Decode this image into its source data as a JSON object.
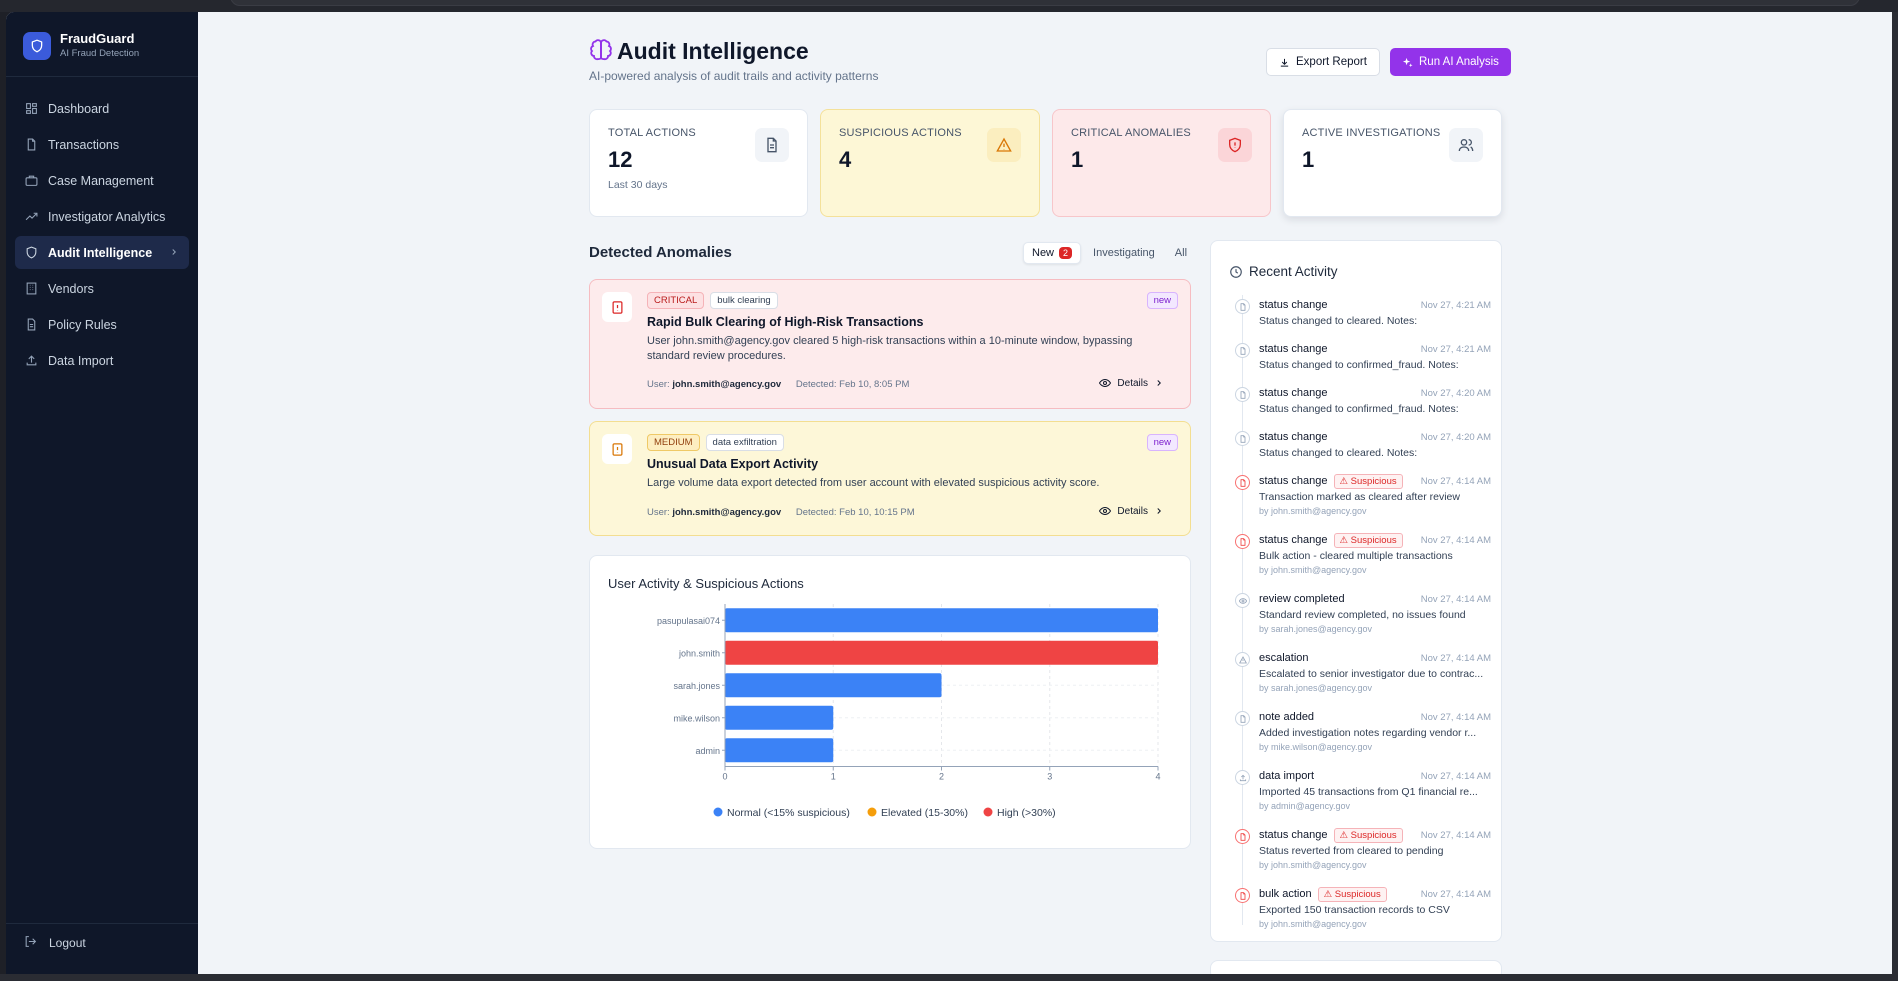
{
  "sidebar": {
    "brand_name": "FraudGuard",
    "brand_sub": "AI Fraud Detection",
    "items": [
      {
        "label": "Dashboard",
        "icon": "dashboard-icon"
      },
      {
        "label": "Transactions",
        "icon": "file-icon"
      },
      {
        "label": "Case Management",
        "icon": "briefcase-icon"
      },
      {
        "label": "Investigator Analytics",
        "icon": "trend-icon"
      },
      {
        "label": "Audit Intelligence",
        "icon": "shield-icon",
        "active": true
      },
      {
        "label": "Vendors",
        "icon": "building-icon"
      },
      {
        "label": "Policy Rules",
        "icon": "document-icon"
      },
      {
        "label": "Data Import",
        "icon": "upload-icon"
      }
    ],
    "logout": "Logout"
  },
  "header": {
    "title": "Audit Intelligence",
    "subtitle": "AI-powered analysis of audit trails and activity patterns",
    "export_label": "Export Report",
    "run_label": "Run AI Analysis"
  },
  "stats": [
    {
      "label": "TOTAL ACTIONS",
      "value": "12",
      "note": "Last 30 days"
    },
    {
      "label": "SUSPICIOUS ACTIONS",
      "value": "4",
      "note": ""
    },
    {
      "label": "CRITICAL ANOMALIES",
      "value": "1",
      "note": ""
    },
    {
      "label": "ACTIVE INVESTIGATIONS",
      "value": "1",
      "note": ""
    }
  ],
  "anomalies": {
    "title": "Detected Anomalies",
    "tabs": {
      "new": "New",
      "new_count": "2",
      "investigating": "Investigating",
      "all": "All"
    },
    "items": [
      {
        "severity": "CRITICAL",
        "category": "bulk clearing",
        "status": "new",
        "title": "Rapid Bulk Clearing of High-Risk Transactions",
        "description": "User john.smith@agency.gov cleared 5 high-risk transactions within a 10-minute window, bypassing standard review procedures.",
        "user_prefix": "User:",
        "user": "john.smith@agency.gov",
        "detected": "Detected: Feb 10, 8:05 PM",
        "details": "Details"
      },
      {
        "severity": "MEDIUM",
        "category": "data exfiltration",
        "status": "new",
        "title": "Unusual Data Export Activity",
        "description": "Large volume data export detected from user account with elevated suspicious activity score.",
        "user_prefix": "User:",
        "user": "john.smith@agency.gov",
        "detected": "Detected: Feb 10, 10:15 PM",
        "details": "Details"
      }
    ]
  },
  "chart_data": {
    "type": "bar",
    "orientation": "horizontal",
    "title": "User Activity & Suspicious Actions",
    "categories": [
      "pasupulasai074",
      "john.smith",
      "sarah.jones",
      "mike.wilson",
      "admin"
    ],
    "values": [
      4,
      4,
      2,
      1,
      1
    ],
    "levels": [
      "normal",
      "high",
      "normal",
      "normal",
      "normal"
    ],
    "xlim": [
      0,
      4
    ],
    "xticks": [
      "0",
      "1",
      "2",
      "3",
      "4"
    ],
    "grid": true,
    "legend_position": "bottom",
    "legend": [
      {
        "name": "Normal (<15% suspicious)",
        "color": "#3b82f6"
      },
      {
        "name": "Elevated (15-30%)",
        "color": "#f59e0b"
      },
      {
        "name": "High (>30%)",
        "color": "#ef4444"
      }
    ]
  },
  "activity": {
    "title": "Recent Activity",
    "suspicious_label": "Suspicious",
    "items": [
      {
        "type": "status change",
        "time": "Nov 27, 4:21 AM",
        "desc": "Status changed to cleared. Notes:",
        "by": "",
        "suspicious": false,
        "icon": "file-icon"
      },
      {
        "type": "status change",
        "time": "Nov 27, 4:21 AM",
        "desc": "Status changed to confirmed_fraud. Notes:",
        "by": "",
        "suspicious": false,
        "icon": "file-icon"
      },
      {
        "type": "status change",
        "time": "Nov 27, 4:20 AM",
        "desc": "Status changed to confirmed_fraud. Notes:",
        "by": "",
        "suspicious": false,
        "icon": "file-icon"
      },
      {
        "type": "status change",
        "time": "Nov 27, 4:20 AM",
        "desc": "Status changed to cleared. Notes:",
        "by": "",
        "suspicious": false,
        "icon": "file-icon"
      },
      {
        "type": "status change",
        "time": "Nov 27, 4:14 AM",
        "desc": "Transaction marked as cleared after review",
        "by": "by john.smith@agency.gov",
        "suspicious": true,
        "icon": "file-icon"
      },
      {
        "type": "status change",
        "time": "Nov 27, 4:14 AM",
        "desc": "Bulk action - cleared multiple transactions",
        "by": "by john.smith@agency.gov",
        "suspicious": true,
        "icon": "file-icon"
      },
      {
        "type": "review completed",
        "time": "Nov 27, 4:14 AM",
        "desc": "Standard review completed, no issues found",
        "by": "by sarah.jones@agency.gov",
        "suspicious": false,
        "icon": "eye-icon"
      },
      {
        "type": "escalation",
        "time": "Nov 27, 4:14 AM",
        "desc": "Escalated to senior investigator due to contrac...",
        "by": "by sarah.jones@agency.gov",
        "suspicious": false,
        "icon": "alert-icon"
      },
      {
        "type": "note added",
        "time": "Nov 27, 4:14 AM",
        "desc": "Added investigation notes regarding vendor r...",
        "by": "by mike.wilson@agency.gov",
        "suspicious": false,
        "icon": "file-icon"
      },
      {
        "type": "data import",
        "time": "Nov 27, 4:14 AM",
        "desc": "Imported 45 transactions from Q1 financial re...",
        "by": "by admin@agency.gov",
        "suspicious": false,
        "icon": "upload-icon"
      },
      {
        "type": "status change",
        "time": "Nov 27, 4:14 AM",
        "desc": "Status reverted from cleared to pending",
        "by": "by john.smith@agency.gov",
        "suspicious": true,
        "icon": "file-icon"
      },
      {
        "type": "bulk action",
        "time": "Nov 27, 4:14 AM",
        "desc": "Exported 150 transaction records to CSV",
        "by": "by john.smith@agency.gov",
        "suspicious": true,
        "icon": "file-icon"
      }
    ]
  },
  "colors": {
    "sidebar_bg": "#0f1729",
    "accent_purple": "#9333ea",
    "normal": "#3b82f6",
    "elevated": "#f59e0b",
    "high": "#ef4444"
  }
}
